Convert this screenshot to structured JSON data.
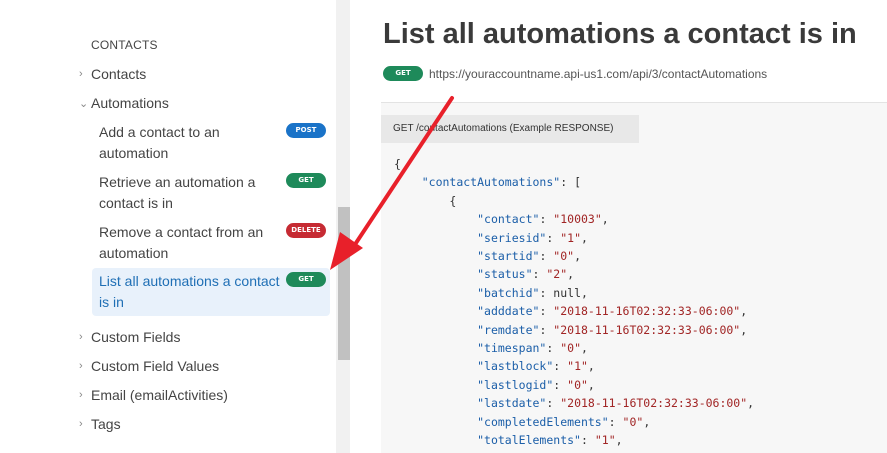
{
  "sidebar": {
    "section_title": "CONTACTS",
    "items": [
      {
        "label": "Contacts",
        "chevron": "chevron-right-icon"
      },
      {
        "label": "Automations",
        "chevron": "chevron-down-icon"
      },
      {
        "label": "Custom Fields",
        "chevron": "chevron-right-icon"
      },
      {
        "label": "Custom Field Values",
        "chevron": "chevron-right-icon"
      },
      {
        "label": "Email (emailActivities)",
        "chevron": "chevron-right-icon"
      },
      {
        "label": "Tags",
        "chevron": "chevron-right-icon"
      }
    ],
    "sub_items": [
      {
        "label": "Add a contact to an automation",
        "method": "POST",
        "color": "#1a73c8"
      },
      {
        "label": "Retrieve an automation a contact is in",
        "method": "GET",
        "color": "#1e8a5a"
      },
      {
        "label": "Remove a contact from an automation",
        "method": "DELETE",
        "color": "#c62b33"
      },
      {
        "label": "List all automations a contact is in",
        "method": "GET",
        "color": "#1e8a5a",
        "active": true
      }
    ]
  },
  "main": {
    "title": "List all automations a contact is in",
    "method": "GET",
    "url": "https://youraccountname.api-us1.com/api/3/contactAutomations",
    "code_tab": "GET /contactAutomations (Example RESPONSE)",
    "code_open": "{",
    "root_key": "contactAutomations",
    "array_open": "[",
    "object_open": "{",
    "fields": [
      {
        "key": "contact",
        "value": "\"10003\""
      },
      {
        "key": "seriesid",
        "value": "\"1\""
      },
      {
        "key": "startid",
        "value": "\"0\""
      },
      {
        "key": "status",
        "value": "\"2\""
      },
      {
        "key": "batchid",
        "value": "null"
      },
      {
        "key": "adddate",
        "value": "\"2018-11-16T02:32:33-06:00\""
      },
      {
        "key": "remdate",
        "value": "\"2018-11-16T02:32:33-06:00\""
      },
      {
        "key": "timespan",
        "value": "\"0\""
      },
      {
        "key": "lastblock",
        "value": "\"1\""
      },
      {
        "key": "lastlogid",
        "value": "\"0\""
      },
      {
        "key": "lastdate",
        "value": "\"2018-11-16T02:32:33-06:00\""
      },
      {
        "key": "completedElements",
        "value": "\"0\""
      },
      {
        "key": "totalElements",
        "value": "\"1\""
      }
    ]
  },
  "colors": {
    "arrow": "#e8202a",
    "active_bg": "#e8f1fb",
    "link": "#1f6fb5"
  }
}
